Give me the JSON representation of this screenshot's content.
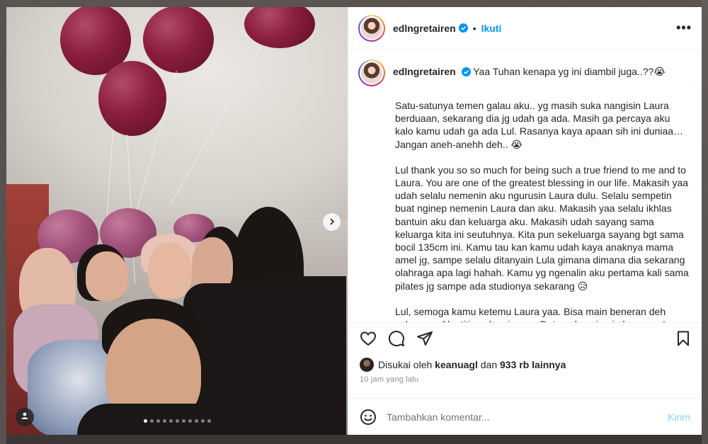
{
  "post": {
    "username": "edlngretairen",
    "follow_label": "Ikuti",
    "separator": "•",
    "more_label": "•••",
    "caption_first_line": "Yaa Tuhan kenapa yg ini diambil juga..??😭",
    "caption_paragraphs": [
      "Satu-satunya temen galau aku.. yg masih suka nangisin Laura berduaan, sekarang dia jg udah ga ada. Masih ga percaya aku kalo kamu udah ga ada Lul. Rasanya kaya apaan sih ini duniaa… Jangan aneh-anehh deh.. 😭",
      "Lul thank you so so much for being such a true friend to me and to Laura. You are one of the greatest blessing in our life. Makasih yaa udah selalu nemenin aku ngurusin Laura dulu. Selalu sempetin buat nginep nemenin Laura dan aku. Makasih yaa selalu ikhlas bantuin aku dan keluarga aku. Makasih udah sayang sama keluarga kita ini seutuhnya. Kita pun sekeluarga sayang bgt sama bocil 135cm ini. Kamu tau kan kamu udah kaya anaknya mama amel jg, sampe selalu ditanyain Lula gimana dimana dia sekarang olahraga apa lagi hahah. Kamu yg ngenalin aku pertama kali sama pilates jg sampe ada studionya sekarang 😥",
      "Lul, semoga kamu ketemu Laura yaa. Bisa main beneran deh sekarang. Aku titip salam jg yaa. Dateng ke mimpi aku sama Laura ya Lul 🤍"
    ],
    "likes_prefix": "Disukai oleh",
    "likes_user": "keanuagl",
    "likes_middle": "dan",
    "likes_count": "933 rb lainnya",
    "timestamp": "10 jam yang lalu",
    "comment_placeholder": "Tambahkan komentar...",
    "post_button": "Kirim",
    "carousel": {
      "total": 11,
      "current": 1
    }
  },
  "colors": {
    "accent": "#0095f6",
    "post_button_disabled": "#8ecbf8",
    "muted_text": "#8e8e8e"
  },
  "icons": {
    "like": "heart-icon",
    "comment": "comment-icon",
    "share": "paper-plane-icon",
    "save": "bookmark-icon",
    "emoji": "smiley-icon",
    "verified": "verified-badge-icon",
    "next": "chevron-right-icon",
    "tag": "user-tag-icon"
  }
}
